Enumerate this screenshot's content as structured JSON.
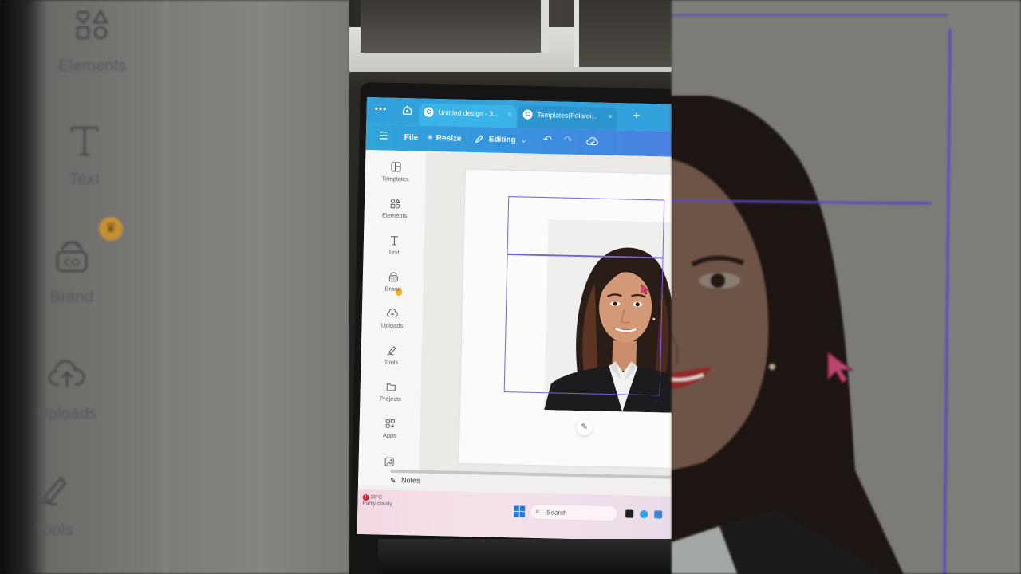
{
  "zoom_left": {
    "items": [
      {
        "label": "Elements",
        "icon": "shapes-icon"
      },
      {
        "label": "Text",
        "icon": "text-icon"
      },
      {
        "label": "Brand",
        "icon": "brand-kit-icon"
      },
      {
        "label": "Uploads",
        "icon": "cloud-upload-icon"
      },
      {
        "label": "Tools",
        "icon": "pen-tool-icon"
      }
    ]
  },
  "browser": {
    "tabs": [
      {
        "label": "Untitled design - 3...",
        "active": true
      },
      {
        "label": "Templates(Polaroi...",
        "active": false
      }
    ]
  },
  "editor_toolbar": {
    "file": "File",
    "resize": "Resize",
    "mode": "Editing"
  },
  "sidebar": {
    "items": [
      {
        "label": "Templates",
        "icon": "templates-icon"
      },
      {
        "label": "Elements",
        "icon": "shapes-icon"
      },
      {
        "label": "Text",
        "icon": "text-icon"
      },
      {
        "label": "Brand",
        "icon": "brand-kit-icon"
      },
      {
        "label": "Uploads",
        "icon": "cloud-upload-icon"
      },
      {
        "label": "Tools",
        "icon": "pen-tool-icon"
      },
      {
        "label": "Projects",
        "icon": "folder-icon"
      },
      {
        "label": "Apps",
        "icon": "apps-grid-icon"
      }
    ]
  },
  "footer": {
    "notes": "Notes"
  },
  "taskbar": {
    "temperature": "26°C",
    "weather": "Partly cloudy",
    "search_placeholder": "Search"
  },
  "colors": {
    "accent_blue": "#32a1dc",
    "selection_purple": "#7b61e8",
    "crown_gold": "#f1b32d"
  }
}
